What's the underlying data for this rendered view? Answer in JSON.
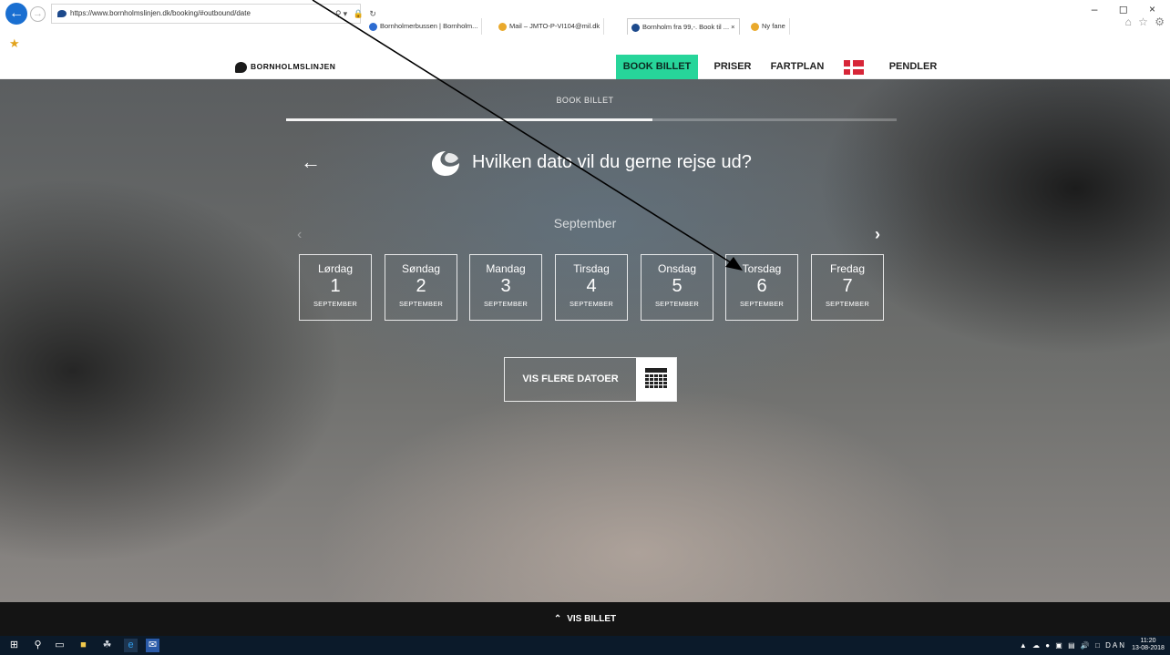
{
  "browser": {
    "url": "https://www.bornholmslinjen.dk/booking/#outbound/date",
    "tabs": [
      {
        "label": "Bornholmerbussen | Bornholm...",
        "icon_color": "#2d6cd1"
      },
      {
        "label": "Mail – JMTO-P-VI104@mil.dk",
        "icon_color": "#e9a92c"
      },
      {
        "label": "Bornholm fra 99,-. Book til ... ×",
        "icon_color": "#1d4a8c"
      },
      {
        "label": "Ny fane",
        "icon_color": "#e9a92c"
      }
    ],
    "window_controls": "– ◻ ×"
  },
  "site": {
    "logo": "BORNHOLMSLINJEN",
    "nav": {
      "book": "BOOK BILLET",
      "prices": "PRISER",
      "schedule": "FARTPLAN",
      "commuter": "PENDLER"
    },
    "accent_color": "#27d59a"
  },
  "booking": {
    "step_title": "BOOK BILLET",
    "progress_fraction": 0.6,
    "question": "Hvilken dato vil du gerne rejse ud?",
    "month": "September",
    "days": [
      {
        "weekday": "Lørdag",
        "date": "1",
        "month": "SEPTEMBER"
      },
      {
        "weekday": "Søndag",
        "date": "2",
        "month": "SEPTEMBER"
      },
      {
        "weekday": "Mandag",
        "date": "3",
        "month": "SEPTEMBER"
      },
      {
        "weekday": "Tirsdag",
        "date": "4",
        "month": "SEPTEMBER"
      },
      {
        "weekday": "Onsdag",
        "date": "5",
        "month": "SEPTEMBER"
      },
      {
        "weekday": "Torsdag",
        "date": "6",
        "month": "SEPTEMBER"
      },
      {
        "weekday": "Fredag",
        "date": "7",
        "month": "SEPTEMBER"
      }
    ],
    "more_dates_label": "VIS FLERE DATOER"
  },
  "bottom_bar": {
    "label": "VIS BILLET"
  },
  "taskbar": {
    "language": "DAN",
    "time": "11:20",
    "date": "13-08-2018"
  }
}
